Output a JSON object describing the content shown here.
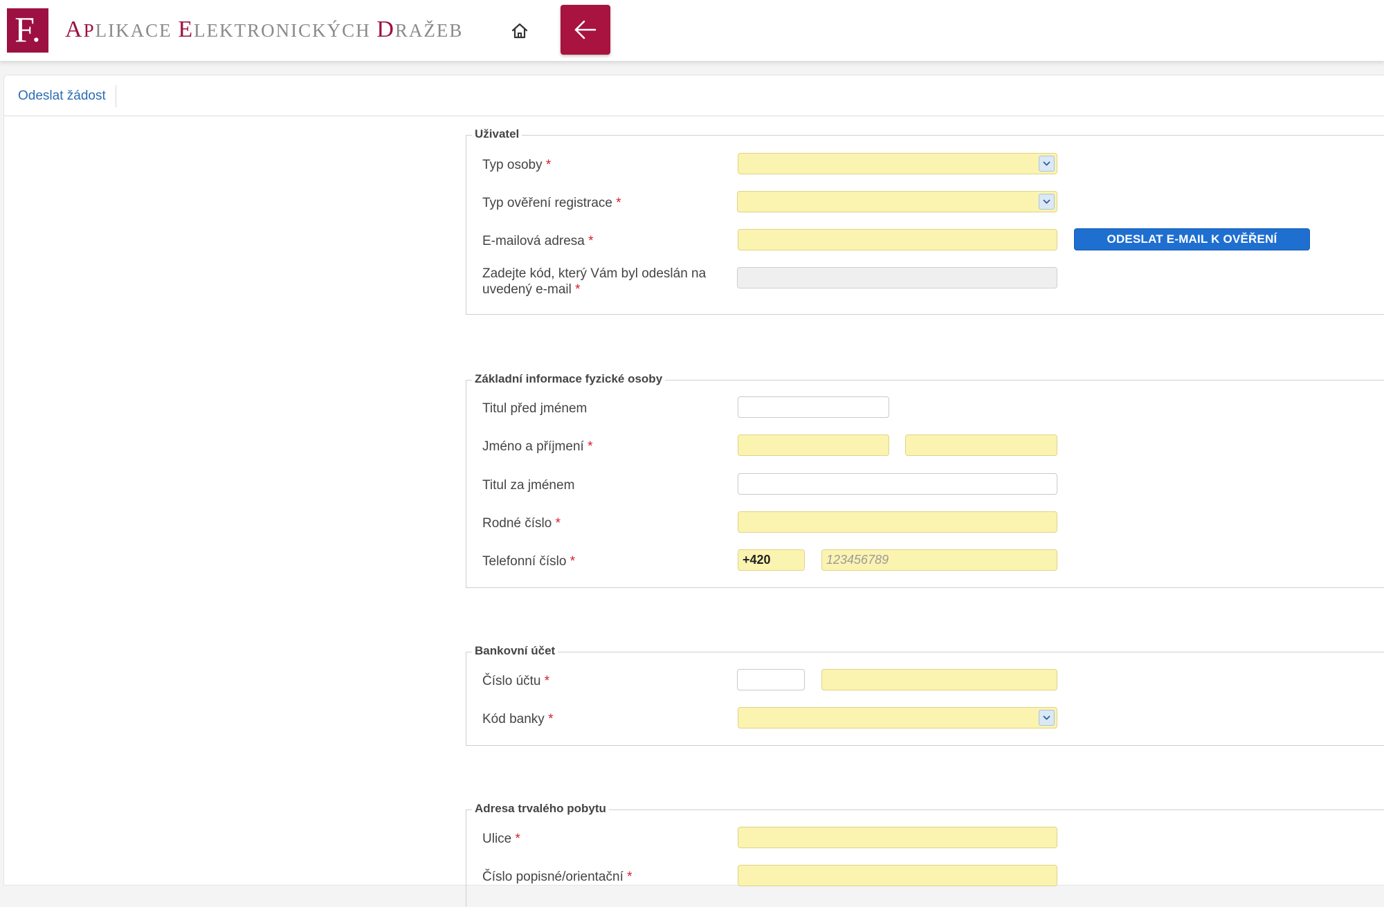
{
  "header": {
    "logo_text": "F.",
    "title_parts": [
      {
        "text": "A",
        "cls": "big red"
      },
      {
        "text": "P",
        "cls": "red"
      },
      {
        "text": "LIKACE ",
        "cls": ""
      },
      {
        "text": "E",
        "cls": "big red"
      },
      {
        "text": "LEKTRONICKÝCH ",
        "cls": ""
      },
      {
        "text": "D",
        "cls": "big red"
      },
      {
        "text": "RAŽEB",
        "cls": ""
      }
    ],
    "home_icon": "home-icon",
    "back_icon": "arrow-left-icon"
  },
  "toolbar": {
    "submit_label": "Odeslat žádost"
  },
  "colors": {
    "brand": "#a8133f",
    "required_bg": "#fbf3b0",
    "link": "#2b6cb4",
    "button": "#1f6fd1"
  },
  "user": {
    "legend": "Uživatel",
    "person_type_label": "Typ osoby",
    "person_type_value": "",
    "verification_type_label": "Typ ověření registrace",
    "verification_type_value": "",
    "email_label": "E-mailová adresa",
    "email_value": "",
    "send_email_button": "ODESLAT E-MAIL K OVĚŘENÍ",
    "code_label": "Zadejte kód, který Vám byl odeslán na uvedený e-mail",
    "code_value": ""
  },
  "person": {
    "legend": "Základní informace fyzické osoby",
    "title_before_label": "Titul před jménem",
    "name_label": "Jméno a příjmení",
    "title_after_label": "Titul za jménem",
    "birth_number_label": "Rodné číslo",
    "phone_label": "Telefonní číslo",
    "phone_prefix": "+420",
    "phone_placeholder": "123456789"
  },
  "bank": {
    "legend": "Bankovní účet",
    "account_label": "Číslo účtu",
    "bank_code_label": "Kód banky"
  },
  "address": {
    "legend": "Adresa trvalého pobytu",
    "street_label": "Ulice",
    "house_number_label": "Číslo popisné/orientační"
  },
  "required_mark": "*"
}
